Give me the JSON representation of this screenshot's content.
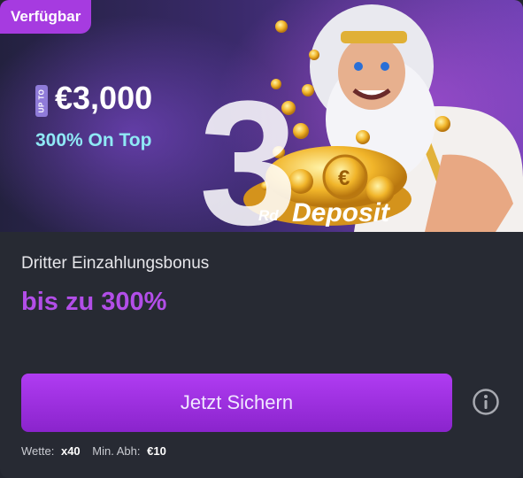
{
  "banner": {
    "badge": "Verfügbar",
    "up_to": "UP TO",
    "amount": "€3,000",
    "subline": "300% On Top",
    "big_digit": "3",
    "rd": "Rd",
    "deposit": "Deposit"
  },
  "offer": {
    "title": "Dritter Einzahlungsbonus",
    "highlight": "bis zu 300%"
  },
  "cta": {
    "label": "Jetzt Sichern"
  },
  "terms": {
    "wager_label": "Wette:",
    "wager_value": "x40",
    "min_label": "Min. Abh:",
    "min_value": "€10"
  },
  "colors": {
    "accent": "#a63be0",
    "highlight_text": "#b24ee8",
    "button": "#9a2fdd",
    "ontop_text": "#8fe9f5",
    "card_bg": "#272a33"
  },
  "icons": {
    "info": "info-circle-icon",
    "hero": "zeus-with-coins-illustration"
  }
}
